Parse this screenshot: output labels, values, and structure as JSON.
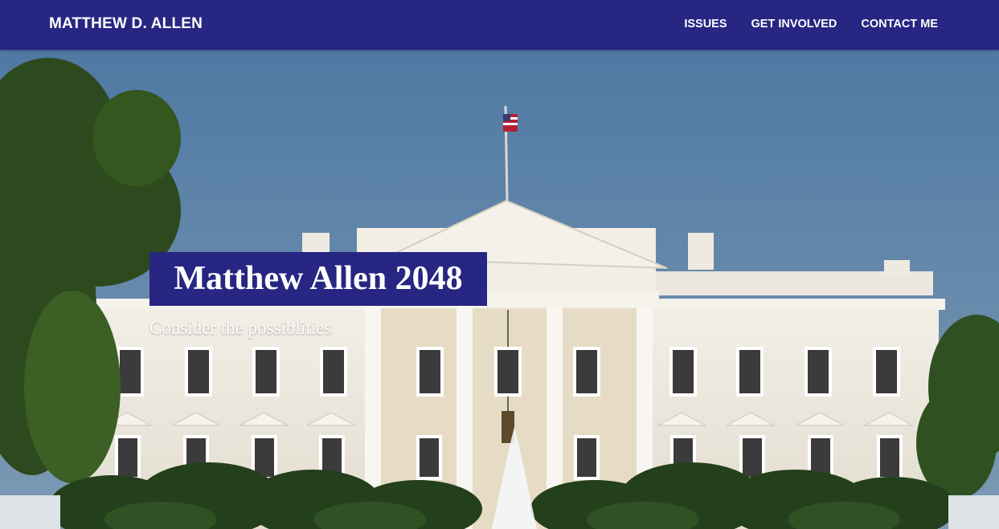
{
  "navbar": {
    "brand": "MATTHEW D. ALLEN",
    "links": [
      "ISSUES",
      "GET INVOLVED",
      "CONTACT ME"
    ]
  },
  "hero": {
    "title": "Matthew Allen 2048",
    "subtitle": "Consider the possiblities",
    "background_image": "white-house-photo"
  },
  "colors": {
    "navbar_bg": "#272682",
    "title_box_bg": "#272682",
    "sky": "#5b83a8",
    "building": "#efece6",
    "foliage": "#2a4a1f"
  }
}
